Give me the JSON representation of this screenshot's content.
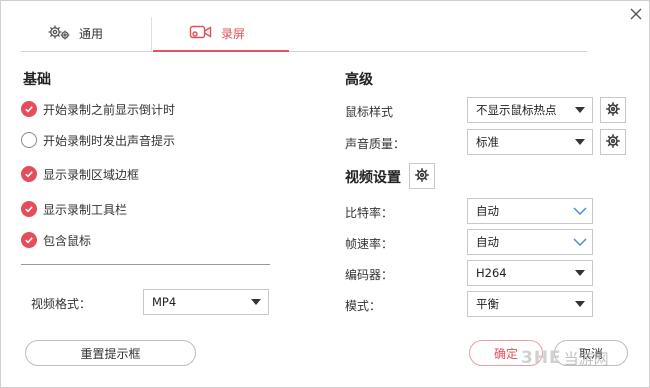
{
  "tabs": [
    {
      "label": "通用",
      "active": false
    },
    {
      "label": "录屏",
      "active": true
    }
  ],
  "colors": {
    "accent": "#e54d5a",
    "border": "#c8c8c8"
  },
  "basic": {
    "title": "基础",
    "options": [
      {
        "label": "开始录制之前显示倒计时",
        "checked": true
      },
      {
        "label": "开始录制时发出声音提示",
        "checked": false
      },
      {
        "label": "显示录制区域边框",
        "checked": true
      },
      {
        "label": "显示录制工具栏",
        "checked": true
      },
      {
        "label": "包含鼠标",
        "checked": true
      }
    ],
    "video_format_label": "视频格式：",
    "video_format_value": "MP4",
    "reset_button": "重置提示框"
  },
  "advanced": {
    "title": "高级",
    "mouse_style_label": "鼠标样式",
    "mouse_style_value": "不显示鼠标热点",
    "audio_quality_label": "声音质量：",
    "audio_quality_value": "标准",
    "video_settings_title": "视频设置",
    "bitrate_label": "比特率：",
    "bitrate_value": "自动",
    "framerate_label": "帧速率：",
    "framerate_value": "自动",
    "encoder_label": "编码器：",
    "encoder_value": "H264",
    "mode_label": "模式：",
    "mode_value": "平衡"
  },
  "footer": {
    "confirm": "确定",
    "cancel": "取消"
  },
  "watermark": {
    "brand": "3HE",
    "site": "当游网"
  }
}
